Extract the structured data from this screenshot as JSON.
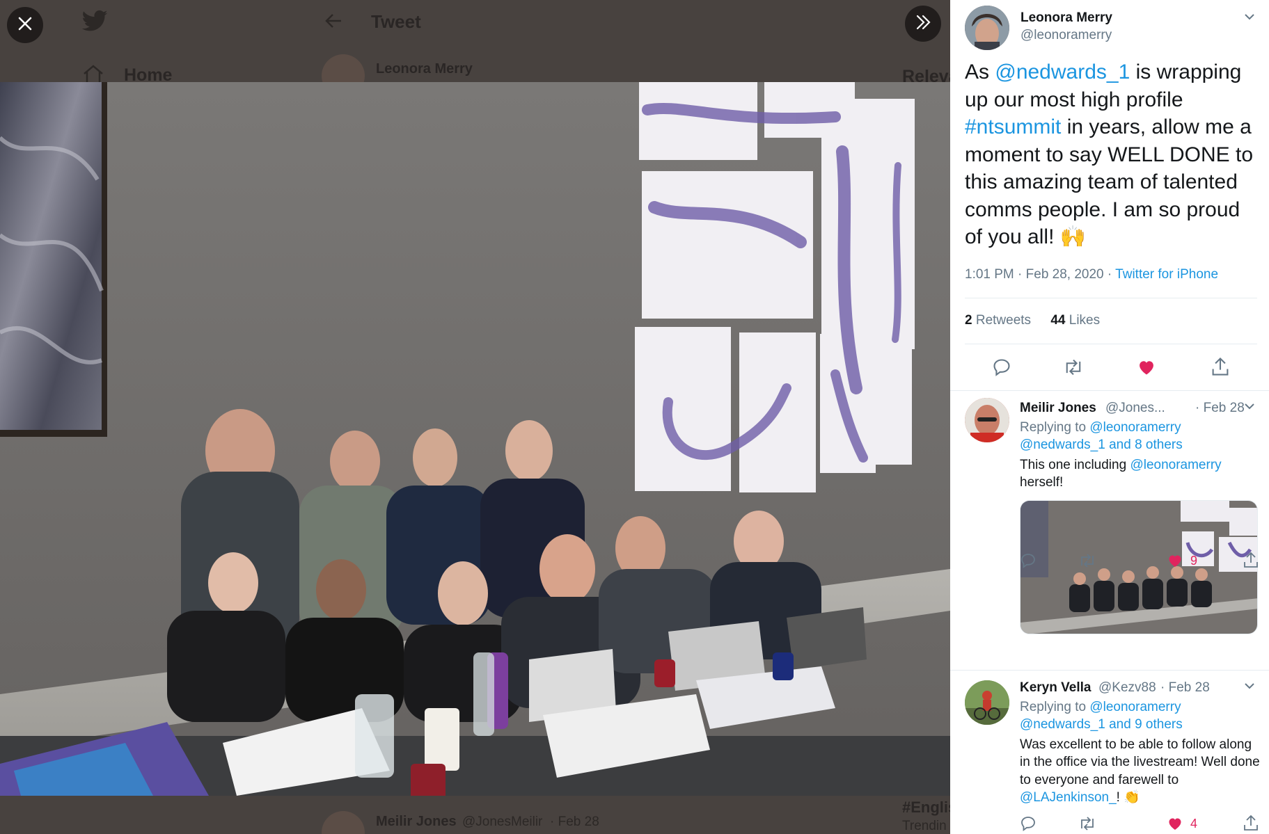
{
  "background": {
    "header_title": "Tweet",
    "nav_home": "Home",
    "bg_author": "Leonora Merry",
    "bg_relevant": "Releva",
    "bg_reply_author": "Meilir Jones",
    "bg_reply_handle": "@JonesMeilir",
    "bg_reply_date": "· Feb 28",
    "bg_trending_tag": "#Englis",
    "bg_trending": "Trendin"
  },
  "tweet": {
    "author_name": "Leonora Merry",
    "author_handle": "@leonoramerry",
    "text_parts": [
      {
        "t": "As ",
        "link": false
      },
      {
        "t": "@nedwards_1",
        "link": true
      },
      {
        "t": " is wrapping up our most high profile ",
        "link": false
      },
      {
        "t": "#ntsummit",
        "link": true
      },
      {
        "t": " in years, allow me a moment to say WELL DONE to this amazing team of talented comms people. I am so proud of you all! 🙌",
        "link": false
      }
    ],
    "time": "1:01 PM · Feb 28, 2020 · ",
    "source": "Twitter for iPhone",
    "retweets_count": "2",
    "retweets_label": "Retweets",
    "likes_count": "44",
    "likes_label": "Likes"
  },
  "replies": [
    {
      "name": "Meilir Jones",
      "handle": "@Jones...",
      "date": "· Feb 28",
      "replying_prefix": "Replying to ",
      "replying_to_1": "@leonoramerry",
      "replying_to_2": "@nedwards_1 and 8 others",
      "text_before": "This one including ",
      "text_mention": "@leonoramerry",
      "text_after": " herself!",
      "likes": "9"
    },
    {
      "name": "Keryn Vella",
      "handle": "@Kezv88",
      "date": "· Feb 28",
      "replying_prefix": "Replying to ",
      "replying_to_1": "@leonoramerry",
      "replying_to_2": "@nedwards_1 and 9 others",
      "text_before": "Was excellent to be able to follow along in the office via the livestream! Well done to everyone and farewell to ",
      "text_mention": "@LAJenkinson_",
      "text_after": "! 👏",
      "likes": "4"
    }
  ],
  "colors": {
    "link": "#1b95e0",
    "like_active": "#e0245e",
    "muted": "#657786"
  }
}
